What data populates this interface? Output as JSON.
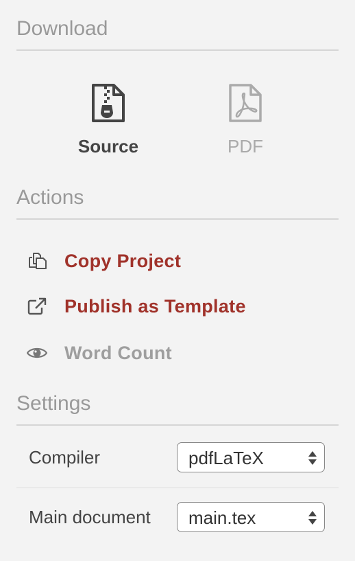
{
  "download": {
    "title": "Download",
    "source_label": "Source",
    "pdf_label": "PDF",
    "source_icon": "zip-file-icon",
    "pdf_icon": "pdf-file-icon"
  },
  "actions": {
    "title": "Actions",
    "items": [
      {
        "label": "Copy Project",
        "icon": "copy-icon",
        "color": "#a0322a"
      },
      {
        "label": "Publish as Template",
        "icon": "external-link-icon",
        "color": "#a0322a"
      },
      {
        "label": "Word Count",
        "icon": "eye-icon",
        "color": "#9e9e9e"
      }
    ]
  },
  "settings": {
    "title": "Settings",
    "compiler": {
      "label": "Compiler",
      "value": "pdfLaTeX"
    },
    "main_document": {
      "label": "Main document",
      "value": "main.tex"
    }
  },
  "colors": {
    "accent": "#a0322a",
    "muted": "#9e9e9e",
    "background": "#f3f3f3"
  }
}
